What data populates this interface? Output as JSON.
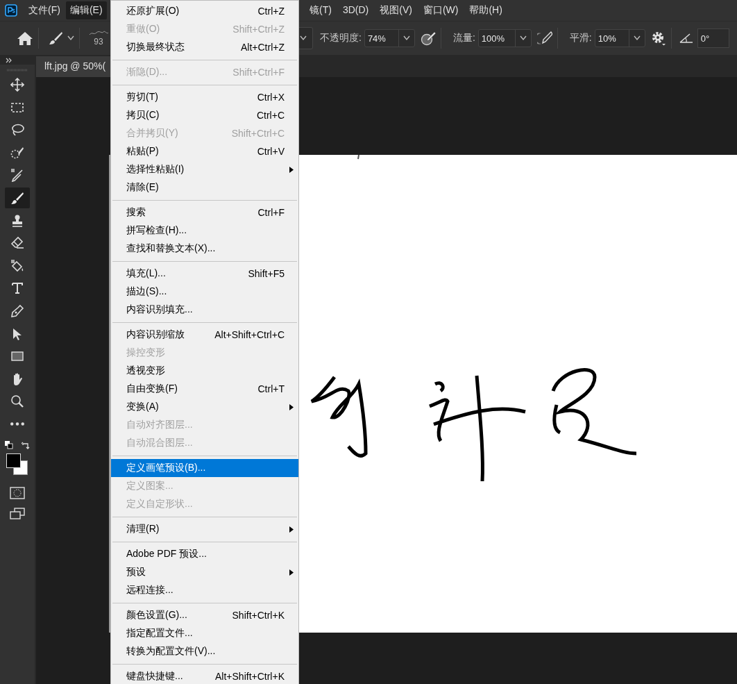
{
  "menubar": {
    "items": [
      {
        "label": "文件(F)",
        "selected": false
      },
      {
        "label": "编辑(E)",
        "selected": true
      },
      {
        "label": "镜(T)",
        "selected": false
      },
      {
        "label": "3D(D)",
        "selected": false
      },
      {
        "label": "视图(V)",
        "selected": false
      },
      {
        "label": "窗口(W)",
        "selected": false
      },
      {
        "label": "帮助(H)",
        "selected": false
      }
    ]
  },
  "options_bar": {
    "brush_size": "93",
    "opacity": {
      "label": "不透明度:",
      "value": "74%"
    },
    "flow": {
      "label": "流量:",
      "value": "100%"
    },
    "smoothing": {
      "label": "平滑:",
      "value": "10%"
    },
    "angle": "0°"
  },
  "document_tab": {
    "title": "lft.jpg @ 50%("
  },
  "tools": [
    {
      "selected": false
    },
    {
      "selected": false
    },
    {
      "selected": false
    },
    {
      "selected": false
    },
    {
      "selected": false
    },
    {
      "selected": true
    },
    {
      "selected": false
    },
    {
      "selected": false
    },
    {
      "selected": false
    },
    {
      "selected": false
    },
    {
      "selected": false
    },
    {
      "selected": false
    },
    {
      "selected": false
    },
    {
      "selected": false
    },
    {
      "selected": false
    },
    {
      "selected": false
    }
  ],
  "edit_menu": {
    "entries": [
      {
        "kind": "item",
        "label": "还原扩展(O)",
        "shortcut": "Ctrl+Z",
        "disabled": false,
        "selected": false,
        "submenu": false
      },
      {
        "kind": "item",
        "label": "重做(O)",
        "shortcut": "Shift+Ctrl+Z",
        "disabled": true,
        "selected": false,
        "submenu": false
      },
      {
        "kind": "item",
        "label": "切换最终状态",
        "shortcut": "Alt+Ctrl+Z",
        "disabled": false,
        "selected": false,
        "submenu": false
      },
      {
        "kind": "separator"
      },
      {
        "kind": "item",
        "label": "渐隐(D)...",
        "shortcut": "Shift+Ctrl+F",
        "disabled": true,
        "selected": false,
        "submenu": false
      },
      {
        "kind": "separator"
      },
      {
        "kind": "item",
        "label": "剪切(T)",
        "shortcut": "Ctrl+X",
        "disabled": false,
        "selected": false,
        "submenu": false
      },
      {
        "kind": "item",
        "label": "拷贝(C)",
        "shortcut": "Ctrl+C",
        "disabled": false,
        "selected": false,
        "submenu": false
      },
      {
        "kind": "item",
        "label": "合并拷贝(Y)",
        "shortcut": "Shift+Ctrl+C",
        "disabled": true,
        "selected": false,
        "submenu": false
      },
      {
        "kind": "item",
        "label": "粘贴(P)",
        "shortcut": "Ctrl+V",
        "disabled": false,
        "selected": false,
        "submenu": false
      },
      {
        "kind": "item",
        "label": "选择性粘贴(I)",
        "disabled": false,
        "selected": false,
        "submenu": true
      },
      {
        "kind": "item",
        "label": "清除(E)",
        "disabled": false,
        "selected": false,
        "submenu": false
      },
      {
        "kind": "separator"
      },
      {
        "kind": "item",
        "label": "搜索",
        "shortcut": "Ctrl+F",
        "disabled": false,
        "selected": false,
        "submenu": false
      },
      {
        "kind": "item",
        "label": "拼写检查(H)...",
        "disabled": false,
        "selected": false,
        "submenu": false
      },
      {
        "kind": "item",
        "label": "查找和替换文本(X)...",
        "disabled": false,
        "selected": false,
        "submenu": false
      },
      {
        "kind": "separator"
      },
      {
        "kind": "item",
        "label": "填充(L)...",
        "shortcut": "Shift+F5",
        "disabled": false,
        "selected": false,
        "submenu": false
      },
      {
        "kind": "item",
        "label": "描边(S)...",
        "disabled": false,
        "selected": false,
        "submenu": false
      },
      {
        "kind": "item",
        "label": "内容识别填充...",
        "disabled": false,
        "selected": false,
        "submenu": false
      },
      {
        "kind": "separator"
      },
      {
        "kind": "item",
        "label": "内容识别缩放",
        "shortcut": "Alt+Shift+Ctrl+C",
        "disabled": false,
        "selected": false,
        "submenu": false
      },
      {
        "kind": "item",
        "label": "操控变形",
        "disabled": true,
        "selected": false,
        "submenu": false
      },
      {
        "kind": "item",
        "label": "透视变形",
        "disabled": false,
        "selected": false,
        "submenu": false
      },
      {
        "kind": "item",
        "label": "自由变换(F)",
        "shortcut": "Ctrl+T",
        "disabled": false,
        "selected": false,
        "submenu": false
      },
      {
        "kind": "item",
        "label": "变换(A)",
        "disabled": false,
        "selected": false,
        "submenu": true
      },
      {
        "kind": "item",
        "label": "自动对齐图层...",
        "disabled": true,
        "selected": false,
        "submenu": false
      },
      {
        "kind": "item",
        "label": "自动混合图层...",
        "disabled": true,
        "selected": false,
        "submenu": false
      },
      {
        "kind": "separator"
      },
      {
        "kind": "item",
        "label": "定义画笔预设(B)...",
        "disabled": false,
        "selected": true,
        "submenu": false
      },
      {
        "kind": "item",
        "label": "定义图案...",
        "disabled": true,
        "selected": false,
        "submenu": false
      },
      {
        "kind": "item",
        "label": "定义自定形状...",
        "disabled": true,
        "selected": false,
        "submenu": false
      },
      {
        "kind": "separator"
      },
      {
        "kind": "item",
        "label": "清理(R)",
        "disabled": false,
        "selected": false,
        "submenu": true
      },
      {
        "kind": "separator"
      },
      {
        "kind": "item",
        "label": "Adobe PDF 预设...",
        "disabled": false,
        "selected": false,
        "submenu": false
      },
      {
        "kind": "item",
        "label": "预设",
        "disabled": false,
        "selected": false,
        "submenu": true
      },
      {
        "kind": "item",
        "label": "远程连接...",
        "disabled": false,
        "selected": false,
        "submenu": false
      },
      {
        "kind": "separator"
      },
      {
        "kind": "item",
        "label": "颜色设置(G)...",
        "shortcut": "Shift+Ctrl+K",
        "disabled": false,
        "selected": false,
        "submenu": false
      },
      {
        "kind": "item",
        "label": "指定配置文件...",
        "disabled": false,
        "selected": false,
        "submenu": false
      },
      {
        "kind": "item",
        "label": "转换为配置文件(V)...",
        "disabled": false,
        "selected": false,
        "submenu": false
      },
      {
        "kind": "separator"
      },
      {
        "kind": "item",
        "label": "键盘快捷键...",
        "shortcut": "Alt+Shift+Ctrl+K",
        "disabled": false,
        "selected": false,
        "submenu": false
      }
    ]
  }
}
